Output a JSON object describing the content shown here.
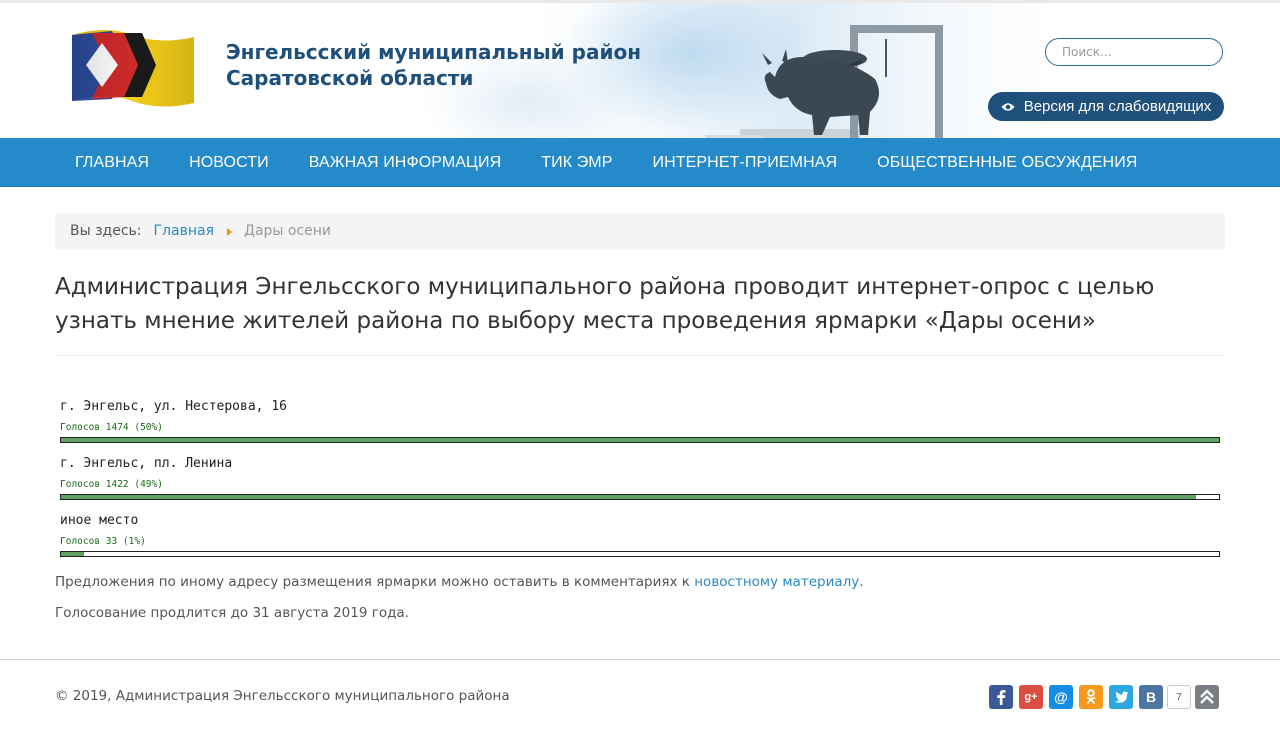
{
  "header": {
    "title_line1": "Энгельсский муниципальный район",
    "title_line2": "Саратовской области",
    "search_placeholder": "Поиск...",
    "lowvision_label": "Версия для слабовидящих",
    "colors": {
      "title": "#1f4f7b",
      "nav": "#248ac9",
      "button": "#1f4f7b"
    }
  },
  "nav": {
    "items": [
      "ГЛАВНАЯ",
      "НОВОСТИ",
      "ВАЖНАЯ ИНФОРМАЦИЯ",
      "ТИК ЭМР",
      "ИНТЕРНЕТ-ПРИЕМНАЯ",
      "ОБЩЕСТВЕННЫЕ ОБСУЖДЕНИЯ"
    ]
  },
  "breadcrumb": {
    "label": "Вы здесь:",
    "home": "Главная",
    "current": "Дары осени"
  },
  "page": {
    "title": "Администрация Энгельсского муниципального района проводит интернет-опрос с целью узнать мнение жителей района по выбору места проведения ярмарки «Дары осени»"
  },
  "poll": {
    "options": [
      {
        "label": "г. Энгельс, ул. Нестерова, 16",
        "votes_text": "Голосов 1474 (50%)",
        "votes": 1474,
        "percent": 50
      },
      {
        "label": "г. Энгельс, пл. Ленина",
        "votes_text": "Голосов 1422 (49%)",
        "votes": 1422,
        "percent": 49
      },
      {
        "label": "иное место",
        "votes_text": "Голосов 33 (1%)",
        "votes": 33,
        "percent": 1
      }
    ],
    "bar_color": "#5fa25f"
  },
  "notes": {
    "suggestion_prefix": "Предложения по иному адресу размещения ярмарки можно оставить в комментариях к ",
    "suggestion_link": "новостному материалу",
    "suggestion_suffix": ".",
    "deadline": "Голосование продлится до 31 августа 2019 года."
  },
  "footer": {
    "copyright": "© 2019, Администрация Энгельсского муниципального района",
    "share_icons": [
      "facebook-icon",
      "google-plus-icon",
      "mailru-icon",
      "odnoklassniki-icon",
      "twitter-icon",
      "vk-icon"
    ],
    "share_labels": {
      "gp": "g+",
      "mr": "@",
      "vk": "B"
    },
    "vk_count": "7"
  }
}
